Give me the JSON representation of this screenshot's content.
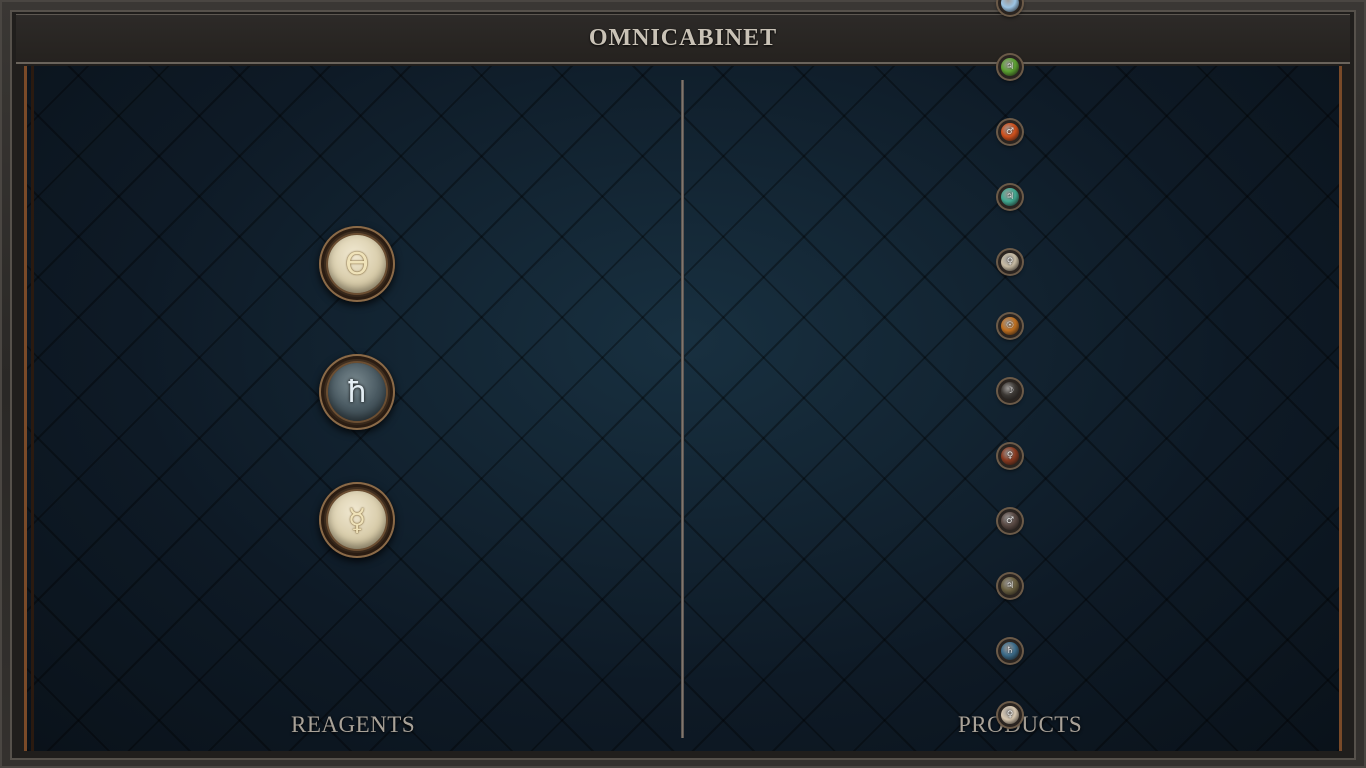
{
  "window": {
    "title": "OMNICABINET"
  },
  "reagents": {
    "label": "REAGENTS",
    "items": [
      {
        "symbol": "ϴ",
        "style": "light",
        "icon": "theta-reagent-icon"
      },
      {
        "symbol": "ħ",
        "style": "dark",
        "icon": "saturn-reagent-icon"
      },
      {
        "symbol": "☿",
        "style": "light",
        "icon": "mercury-reagent-icon"
      }
    ]
  },
  "products": {
    "label": "PRODUCTS",
    "items": [
      {
        "symbol": "",
        "color": "#9cc4e4",
        "icon": "blue-gem-icon"
      },
      {
        "symbol": "♃",
        "color": "#5aa030",
        "icon": "green-gem-icon"
      },
      {
        "symbol": "♂",
        "color": "#d0501c",
        "icon": "red-gem-icon"
      },
      {
        "symbol": "♃",
        "color": "#40a890",
        "icon": "teal-gem-icon"
      },
      {
        "symbol": "♀",
        "color": "#c8bca4",
        "icon": "pale-gem-icon"
      },
      {
        "symbol": "☉",
        "color": "#c07020",
        "icon": "orange-gem-icon"
      },
      {
        "symbol": "☽",
        "color": "#3c3834",
        "icon": "dark-gem-icon"
      },
      {
        "symbol": "♀",
        "color": "#8a3a20",
        "icon": "rust-gem-icon"
      },
      {
        "symbol": "♂",
        "color": "#5a4a44",
        "icon": "brown-gem-icon"
      },
      {
        "symbol": "♃",
        "color": "#6a6040",
        "icon": "olive-gem-icon"
      },
      {
        "symbol": "♄",
        "color": "#3a6a88",
        "icon": "steel-gem-icon"
      },
      {
        "symbol": "♀",
        "color": "#d8c8b0",
        "icon": "ivory-gem-icon"
      }
    ]
  }
}
